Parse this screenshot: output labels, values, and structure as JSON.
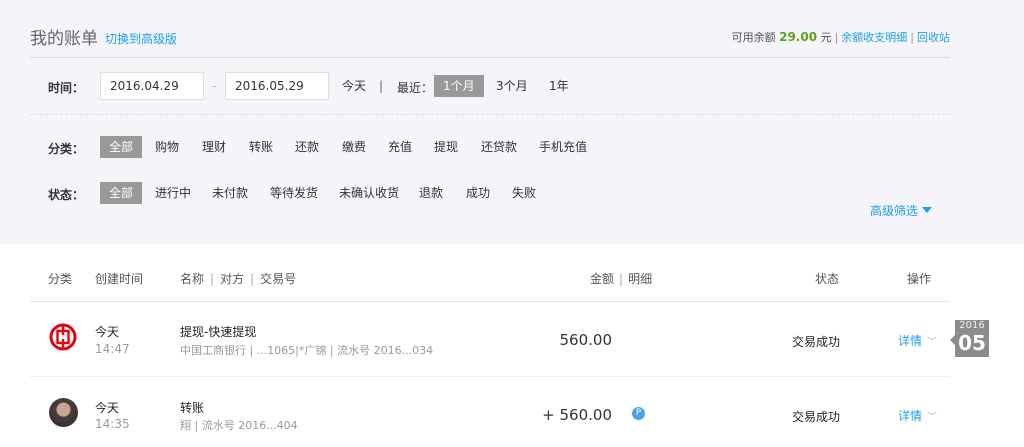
{
  "header": {
    "title": "我的账单",
    "switch_link": "切换到高级版",
    "balance_label": "可用余额",
    "balance_amount": "29.00",
    "balance_unit": "元",
    "balance_detail_link": "余额收支明细",
    "recycle_link": "回收站"
  },
  "filters": {
    "time_label": "时间：",
    "start_date": "2016.04.29",
    "date_sep": "-",
    "end_date": "2016.05.29",
    "today": "今天",
    "divider": "|",
    "recent_label": "最近：",
    "recent_options": [
      {
        "label": "1个月",
        "selected": true
      },
      {
        "label": "3个月",
        "selected": false
      },
      {
        "label": "1年",
        "selected": false
      }
    ],
    "category_label": "分类：",
    "categories": [
      {
        "label": "全部",
        "selected": true
      },
      {
        "label": "购物"
      },
      {
        "label": "理财"
      },
      {
        "label": "转账"
      },
      {
        "label": "还款"
      },
      {
        "label": "缴费"
      },
      {
        "label": "充值"
      },
      {
        "label": "提现"
      },
      {
        "label": "还贷款"
      },
      {
        "label": "手机充值"
      }
    ],
    "status_label": "状态：",
    "statuses": [
      {
        "label": "全部",
        "selected": true
      },
      {
        "label": "进行中"
      },
      {
        "label": "未付款"
      },
      {
        "label": "等待发货"
      },
      {
        "label": "未确认收货"
      },
      {
        "label": "退款"
      },
      {
        "label": "成功"
      },
      {
        "label": "失败"
      }
    ],
    "advanced": "高级筛选"
  },
  "table": {
    "headers": {
      "category": "分类",
      "created": "创建时间",
      "name": "名称",
      "party": "对方",
      "trade_no": "交易号",
      "amount": "金额",
      "detail": "明细",
      "status": "状态",
      "action": "操作"
    },
    "rows": [
      {
        "icon": "icbc-bank-logo",
        "day": "今天",
        "time": "14:47",
        "name": "提现-快速提现",
        "sub": "中国工商银行 | ...1065|*广锦 | 流水号 2016...034",
        "amount": "560.00",
        "status": "交易成功",
        "action": "详情"
      },
      {
        "icon": "user-avatar",
        "day": "今天",
        "time": "14:35",
        "name": "转账",
        "sub": "翔 | 流水号 2016...404",
        "amount": "+ 560.00",
        "status": "交易成功",
        "action": "详情"
      }
    ]
  },
  "date_marker": {
    "year": "2016",
    "month": "05"
  },
  "colors": {
    "accent": "#1ea1e9",
    "balance": "#5ea31c",
    "selected": "#999999",
    "icbc": "#e60012"
  }
}
